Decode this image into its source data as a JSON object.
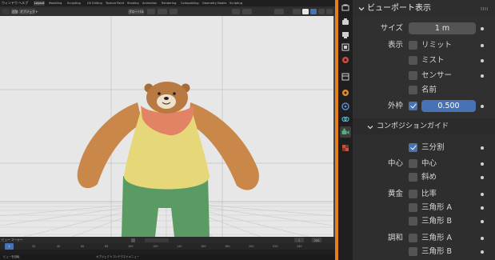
{
  "topbar": {
    "menus": [
      "ウィンドウ",
      "ヘルプ"
    ],
    "workspaces": [
      "Layout",
      "Modeling",
      "Sculpting",
      "UV Editing",
      "Texture Paint",
      "Shading",
      "Animation",
      "Rendering",
      "Compositing",
      "Geometry Nodes",
      "Scripting"
    ],
    "active_workspace": "Layout"
  },
  "viewport_header": {
    "add_label": "追加",
    "object_label": "オブジェクト",
    "orientation_label": "グローバル"
  },
  "timeline": {
    "header_items": [
      "ビュー",
      "マーカー"
    ],
    "current_frame": "1",
    "start_frame": "1",
    "end_frame": "250",
    "ticks": [
      "0",
      "20",
      "40",
      "60",
      "80",
      "100",
      "120",
      "140",
      "160",
      "180",
      "200",
      "220",
      "240"
    ]
  },
  "statusbar": {
    "items": [
      "ビューを回転",
      "オブジェクトコンテクストメニュー"
    ]
  },
  "properties": {
    "panel_title": "ビューポート表示",
    "size_label": "サイズ",
    "size_value": "1 m",
    "show_label": "表示",
    "show_options": [
      {
        "label": "リミット",
        "checked": false
      },
      {
        "label": "ミスト",
        "checked": false
      },
      {
        "label": "センサー",
        "checked": false
      },
      {
        "label": "名前",
        "checked": false
      }
    ],
    "passepartout_label": "外枠",
    "passepartout_checked": true,
    "passepartout_value": "0.500",
    "composition_title": "コンポジションガイド",
    "thirds_label": "三分割",
    "thirds_checked": true,
    "center_group_label": "中心",
    "center_options": [
      {
        "label": "中心",
        "checked": false
      },
      {
        "label": "斜め",
        "checked": false
      }
    ],
    "golden_group_label": "黄金",
    "golden_options": [
      {
        "label": "比率",
        "checked": false
      },
      {
        "label": "三角形 A",
        "checked": false
      },
      {
        "label": "三角形 B",
        "checked": false
      }
    ],
    "harmony_group_label": "調和",
    "harmony_options": [
      {
        "label": "三角形 A",
        "checked": false
      },
      {
        "label": "三角形 B",
        "checked": false
      }
    ]
  },
  "colors": {
    "accent_orange": "#e5801a",
    "checkbox_blue": "#4772b3",
    "bear_fur": "#c98749",
    "shirt_yellow": "#e6d879",
    "scarf_salmon": "#e28366",
    "pants_green": "#5a9a63"
  },
  "property_tabs": [
    "tool-icon",
    "render-icon",
    "output-icon",
    "view-layer-icon",
    "scene-icon",
    "world-icon",
    "collection-icon",
    "object-icon",
    "modifier-icon",
    "physics-icon",
    "constraints-icon",
    "camera-data-icon",
    "texture-icon"
  ]
}
